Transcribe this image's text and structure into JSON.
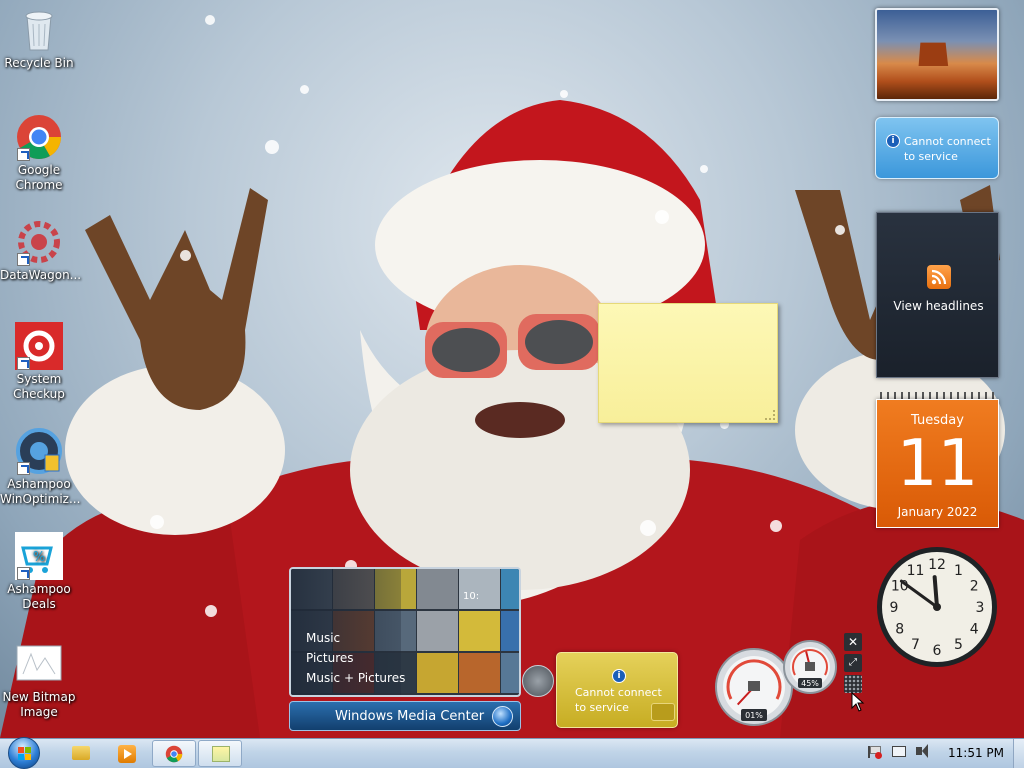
{
  "desktop_icons": [
    {
      "label": "Recycle Bin",
      "icon": "recycle-bin-icon"
    },
    {
      "label": "Google Chrome",
      "icon": "chrome-icon"
    },
    {
      "label": "DataWagon...",
      "icon": "datawagon-icon"
    },
    {
      "label": "System Checkup",
      "icon": "system-checkup-icon"
    },
    {
      "label": "Ashampoo WinOptimiz...",
      "icon": "winoptimizer-icon"
    },
    {
      "label": "Ashampoo Deals",
      "icon": "ashampoo-deals-icon"
    },
    {
      "label": "New Bitmap Image",
      "icon": "bitmap-image-icon"
    }
  ],
  "gadgets": {
    "weather": {
      "text": "Cannot connect to service"
    },
    "feed": {
      "text": "View headlines"
    },
    "calendar": {
      "day_name": "Tuesday",
      "day": "11",
      "month_year": "January 2022"
    },
    "currency": {
      "text": "Cannot connect to service"
    },
    "meter": {
      "cpu": "01%",
      "memory": "45%",
      "cpu_value": 1,
      "memory_value": 45
    },
    "clock": {
      "numbers": [
        "12",
        "1",
        "2",
        "3",
        "4",
        "5",
        "6",
        "7",
        "8",
        "9",
        "10",
        "11"
      ],
      "hour": 11,
      "minute": 51
    }
  },
  "media_center": {
    "menu": [
      "Music",
      "Pictures",
      "Music + Pictures"
    ],
    "brand": "Windows Media Center",
    "tile_time": "10:"
  },
  "taskbar": {
    "time": "11:51 PM",
    "pinned": [
      "explorer-icon",
      "media-player-icon",
      "chrome-icon",
      "sticky-notes-icon"
    ]
  },
  "colors": {
    "calendar": "#e8660c",
    "currency": "#d8c23a",
    "taskbar": "#c0d4e8",
    "sticky": "#fcf5a8"
  }
}
